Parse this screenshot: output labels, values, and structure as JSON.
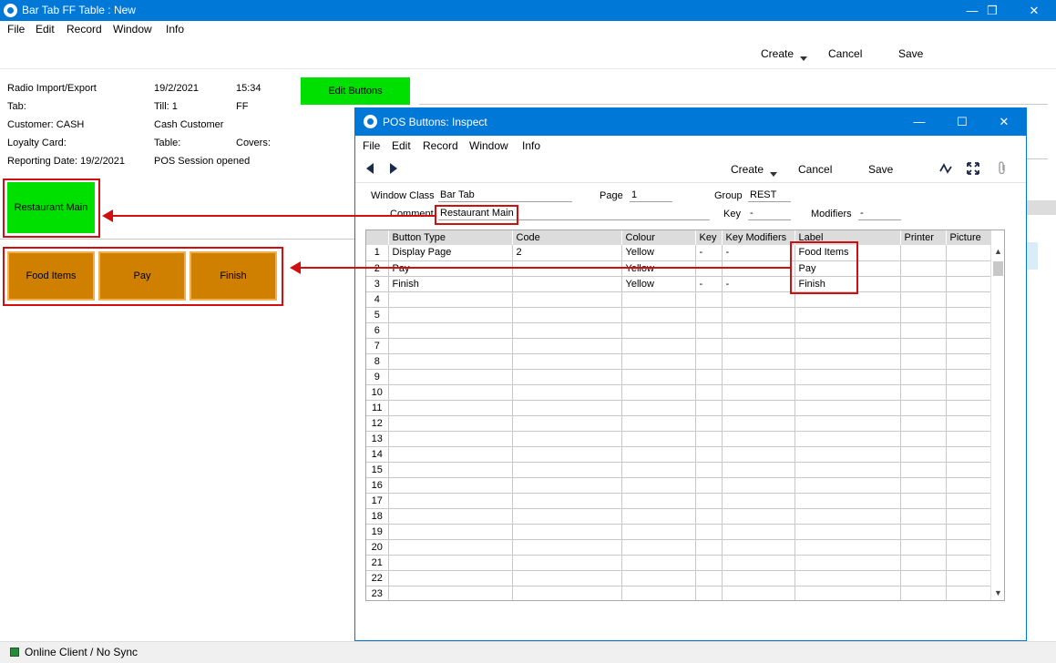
{
  "main_window": {
    "title": "Bar Tab FF Table : New",
    "controls": {
      "minimize": "—",
      "restore": "❐",
      "close": "✕"
    },
    "menu": [
      "File",
      "Edit",
      "Record",
      "Window",
      "Info"
    ],
    "toolbar": {
      "create": "Create",
      "cancel": "Cancel",
      "save": "Save"
    },
    "info": {
      "radio": "Radio Import/Export",
      "date": "19/2/2021",
      "time": "15:34",
      "tab": "Tab:",
      "till": "Till: 1",
      "ff": "FF",
      "customer": "Customer: CASH",
      "customer_name": "Cash Customer",
      "loyalty": "Loyalty Card:",
      "table": "Table:",
      "covers": "Covers:",
      "reporting": "Reporting Date: 19/2/2021",
      "session": "POS Session opened"
    },
    "edit_buttons": "Edit Buttons",
    "pos_main_button": "Restaurant Main",
    "pos_buttons": [
      "Food Items",
      "Pay",
      "Finish"
    ]
  },
  "status_bar": {
    "text": "Online Client / No Sync"
  },
  "dialog": {
    "title": "POS Buttons: Inspect",
    "controls": {
      "minimize": "—",
      "maximize": "☐",
      "close": "✕"
    },
    "menu": [
      "File",
      "Edit",
      "Record",
      "Window",
      "Info"
    ],
    "toolbar": {
      "create": "Create",
      "cancel": "Cancel",
      "save": "Save"
    },
    "fields": {
      "window_class_label": "Window Class",
      "window_class": "Bar Tab",
      "page_label": "Page",
      "page": "1",
      "group_label": "Group",
      "group": "REST",
      "comment_label": "Comment",
      "comment": "Restaurant Main",
      "key_label": "Key",
      "key": "-",
      "modifiers_label": "Modifiers",
      "modifiers": "-"
    },
    "columns": [
      "",
      "Button Type",
      "Code",
      "Colour",
      "Key",
      "Key Modifiers",
      "Label",
      "Printer",
      "Picture"
    ],
    "rows": [
      [
        "1",
        "Display Page",
        "2",
        "Yellow",
        "-",
        "-",
        "Food Items",
        "",
        ""
      ],
      [
        "2",
        "Pay",
        "",
        "Yellow",
        "",
        "",
        "Pay",
        "",
        ""
      ],
      [
        "3",
        "Finish",
        "",
        "Yellow",
        "-",
        "-",
        "Finish",
        "",
        ""
      ],
      [
        "4",
        "",
        "",
        "",
        "",
        "",
        "",
        "",
        ""
      ],
      [
        "5",
        "",
        "",
        "",
        "",
        "",
        "",
        "",
        ""
      ],
      [
        "6",
        "",
        "",
        "",
        "",
        "",
        "",
        "",
        ""
      ],
      [
        "7",
        "",
        "",
        "",
        "",
        "",
        "",
        "",
        ""
      ],
      [
        "8",
        "",
        "",
        "",
        "",
        "",
        "",
        "",
        ""
      ],
      [
        "9",
        "",
        "",
        "",
        "",
        "",
        "",
        "",
        ""
      ],
      [
        "10",
        "",
        "",
        "",
        "",
        "",
        "",
        "",
        ""
      ],
      [
        "11",
        "",
        "",
        "",
        "",
        "",
        "",
        "",
        ""
      ],
      [
        "12",
        "",
        "",
        "",
        "",
        "",
        "",
        "",
        ""
      ],
      [
        "13",
        "",
        "",
        "",
        "",
        "",
        "",
        "",
        ""
      ],
      [
        "14",
        "",
        "",
        "",
        "",
        "",
        "",
        "",
        ""
      ],
      [
        "15",
        "",
        "",
        "",
        "",
        "",
        "",
        "",
        ""
      ],
      [
        "16",
        "",
        "",
        "",
        "",
        "",
        "",
        "",
        ""
      ],
      [
        "17",
        "",
        "",
        "",
        "",
        "",
        "",
        "",
        ""
      ],
      [
        "18",
        "",
        "",
        "",
        "",
        "",
        "",
        "",
        ""
      ],
      [
        "19",
        "",
        "",
        "",
        "",
        "",
        "",
        "",
        ""
      ],
      [
        "20",
        "",
        "",
        "",
        "",
        "",
        "",
        "",
        ""
      ],
      [
        "21",
        "",
        "",
        "",
        "",
        "",
        "",
        "",
        ""
      ],
      [
        "22",
        "",
        "",
        "",
        "",
        "",
        "",
        "",
        ""
      ],
      [
        "23",
        "",
        "",
        "",
        "",
        "",
        "",
        "",
        ""
      ]
    ]
  },
  "colors": {
    "titlebar": "#0078d7",
    "green_button": "#00e000",
    "orange_button": "#d08000",
    "annotation_red": "#d01010"
  }
}
